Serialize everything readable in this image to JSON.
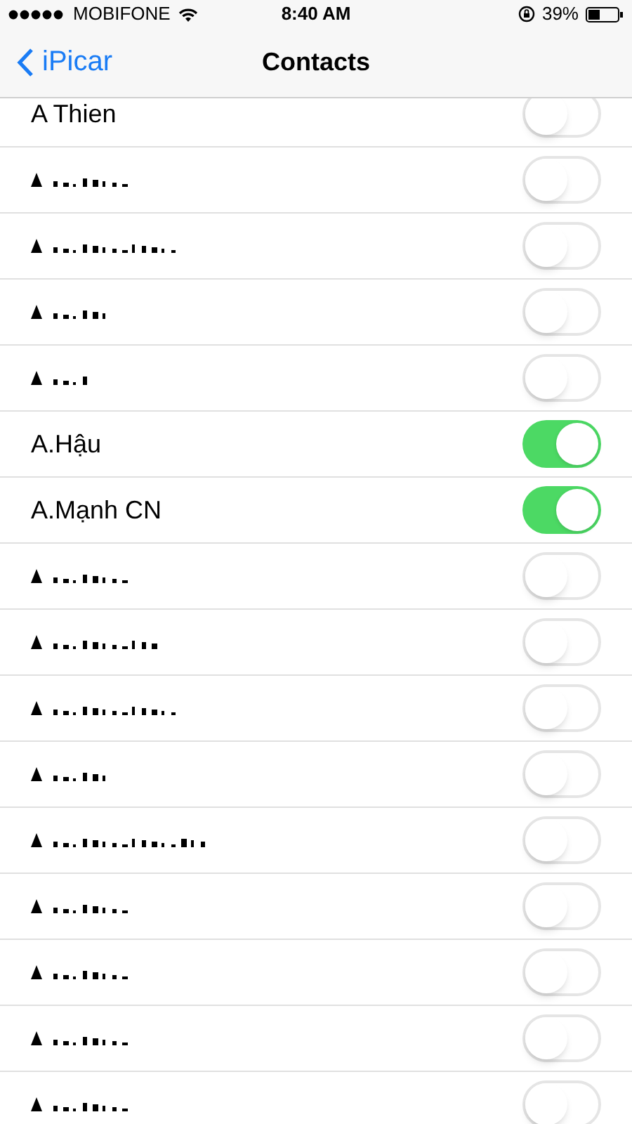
{
  "status_bar": {
    "carrier": "MOBIFONE",
    "time": "8:40 AM",
    "battery": "39%"
  },
  "nav": {
    "back": "iPicar",
    "title": "Contacts"
  },
  "contacts": [
    {
      "kind": "name",
      "name": "A Thien",
      "on": false
    },
    {
      "kind": "obscured",
      "on": false
    },
    {
      "kind": "obscured",
      "on": false
    },
    {
      "kind": "obscured",
      "on": false
    },
    {
      "kind": "obscured",
      "on": false
    },
    {
      "kind": "name",
      "name": "A.Hậu",
      "on": true
    },
    {
      "kind": "name",
      "name": "A.Mạnh CN",
      "on": true
    },
    {
      "kind": "obscured",
      "on": false
    },
    {
      "kind": "obscured",
      "on": false
    },
    {
      "kind": "obscured",
      "on": false
    },
    {
      "kind": "obscured",
      "on": false
    },
    {
      "kind": "obscured",
      "on": false
    },
    {
      "kind": "obscured",
      "on": false
    },
    {
      "kind": "obscured",
      "on": false
    },
    {
      "kind": "obscured",
      "on": false
    },
    {
      "kind": "obscured",
      "on": false
    }
  ]
}
